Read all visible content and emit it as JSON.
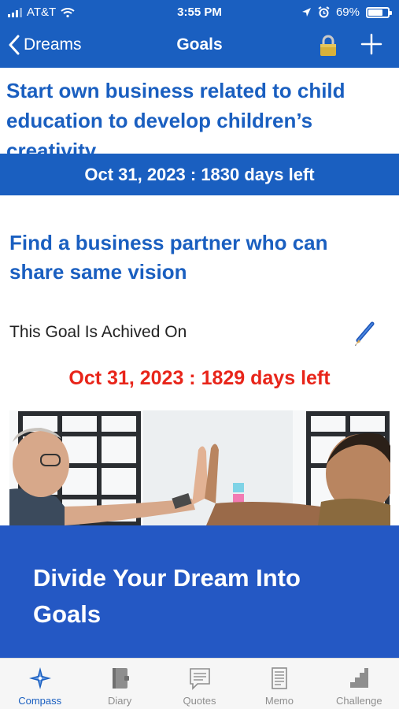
{
  "status_bar": {
    "carrier": "AT&T",
    "time": "3:55 PM",
    "battery": "69%",
    "battery_level": 0.69
  },
  "nav": {
    "back_label": "Dreams",
    "title": "Goals"
  },
  "goals": [
    {
      "title": "Start own business related to child education to develop children’s creativity",
      "date_text": "Oct 31, 2023 : 1830 days left"
    },
    {
      "title": "Find a business partner who can share same vision",
      "achieved_label": "This Goal Is Achived On",
      "date_text": "Oct 31, 2023 : 1829 days left"
    }
  ],
  "cta": {
    "text": "Divide Your Dream Into Goals"
  },
  "tabs": [
    {
      "label": "Compass",
      "icon": "compass-icon",
      "active": true
    },
    {
      "label": "Diary",
      "icon": "diary-icon",
      "active": false
    },
    {
      "label": "Quotes",
      "icon": "quotes-icon",
      "active": false
    },
    {
      "label": "Memo",
      "icon": "memo-icon",
      "active": false
    },
    {
      "label": "Challenge",
      "icon": "challenge-icon",
      "active": false
    }
  ],
  "colors": {
    "primary": "#1a5fc0",
    "cta_background": "#2458c4",
    "alert_red": "#e8251a",
    "tab_inactive": "#8e8e8e"
  }
}
